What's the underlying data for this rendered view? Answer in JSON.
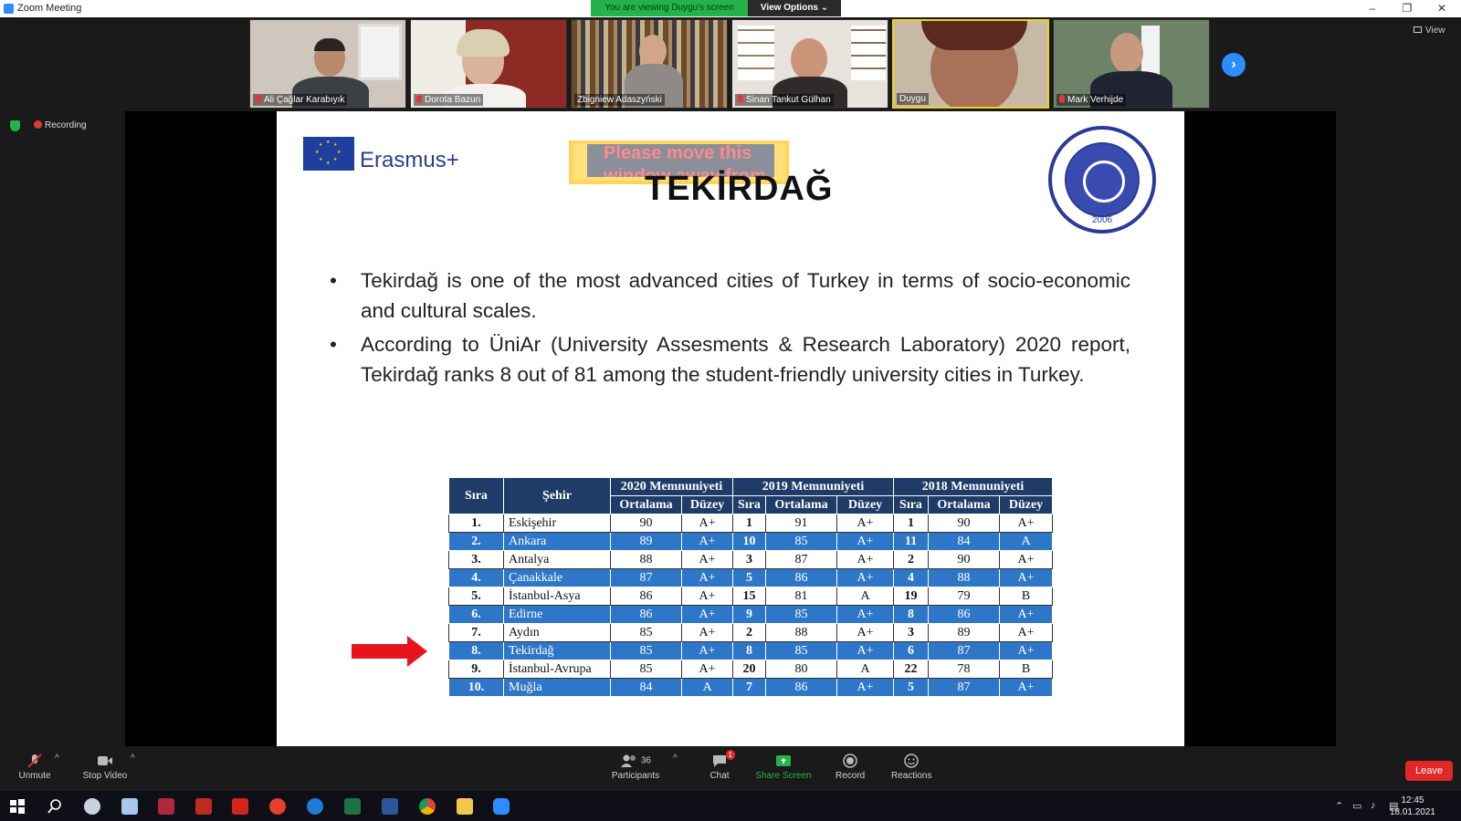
{
  "window": {
    "title": "Zoom Meeting",
    "min": "–",
    "max": "❐",
    "close": "✕"
  },
  "banner": {
    "viewing": "You are viewing Duygu's screen",
    "view_options": "View Options ⌄"
  },
  "gallery": {
    "participants": [
      {
        "name": "Ali Çağlar Karabıyık",
        "muted": true
      },
      {
        "name": "Dorota Bazun",
        "muted": true
      },
      {
        "name": "Zbigniew Adaszyński",
        "muted": false
      },
      {
        "name": "Sinan Tankut Gülhan",
        "muted": true
      },
      {
        "name": "Duygu",
        "muted": false
      },
      {
        "name": "Mark Verhijde",
        "muted": true
      }
    ],
    "next_icon": "›",
    "view_label": "View"
  },
  "status": {
    "recording": "Recording"
  },
  "slide": {
    "brand": "Erasmus+",
    "overlay_text": "Please move this window away from",
    "title": "TEKİRDAĞ",
    "seal_year": "2006",
    "bullet_symbol": "•",
    "bullets": [
      "Tekirdağ is one of the most advanced cities of Turkey in terms of socio-economic and cultural scales.",
      "According to ÜniAr (University Assesments & Research Laboratory) 2020 report, Tekirdağ ranks 8 out of 81 among the student-friendly university cities in Turkey."
    ],
    "table": {
      "h_rank": "Sıra",
      "h_city": "Şehir",
      "h_2020": "2020 Memnuniyeti",
      "h_2019": "2019 Memnuniyeti",
      "h_2018": "2018 Memnuniyeti",
      "h_avg": "Ortalama",
      "h_level": "Düzey",
      "h_sira": "Sıra",
      "rows": [
        {
          "rank": "1.",
          "city": "Eskişehir",
          "avg20": "90",
          "lvl20": "A+",
          "r19": "1",
          "avg19": "91",
          "lvl19": "A+",
          "r18": "1",
          "avg18": "90",
          "lvl18": "A+"
        },
        {
          "rank": "2.",
          "city": "Ankara",
          "avg20": "89",
          "lvl20": "A+",
          "r19": "10",
          "avg19": "85",
          "lvl19": "A+",
          "r18": "11",
          "avg18": "84",
          "lvl18": "A"
        },
        {
          "rank": "3.",
          "city": "Antalya",
          "avg20": "88",
          "lvl20": "A+",
          "r19": "3",
          "avg19": "87",
          "lvl19": "A+",
          "r18": "2",
          "avg18": "90",
          "lvl18": "A+"
        },
        {
          "rank": "4.",
          "city": "Çanakkale",
          "avg20": "87",
          "lvl20": "A+",
          "r19": "5",
          "avg19": "86",
          "lvl19": "A+",
          "r18": "4",
          "avg18": "88",
          "lvl18": "A+"
        },
        {
          "rank": "5.",
          "city": "İstanbul-Asya",
          "avg20": "86",
          "lvl20": "A+",
          "r19": "15",
          "avg19": "81",
          "lvl19": "A",
          "r18": "19",
          "avg18": "79",
          "lvl18": "B"
        },
        {
          "rank": "6.",
          "city": "Edirne",
          "avg20": "86",
          "lvl20": "A+",
          "r19": "9",
          "avg19": "85",
          "lvl19": "A+",
          "r18": "8",
          "avg18": "86",
          "lvl18": "A+"
        },
        {
          "rank": "7.",
          "city": "Aydın",
          "avg20": "85",
          "lvl20": "A+",
          "r19": "2",
          "avg19": "88",
          "lvl19": "A+",
          "r18": "3",
          "avg18": "89",
          "lvl18": "A+"
        },
        {
          "rank": "8.",
          "city": "Tekirdağ",
          "avg20": "85",
          "lvl20": "A+",
          "r19": "8",
          "avg19": "85",
          "lvl19": "A+",
          "r18": "6",
          "avg18": "87",
          "lvl18": "A+"
        },
        {
          "rank": "9.",
          "city": "İstanbul-Avrupa",
          "avg20": "85",
          "lvl20": "A+",
          "r19": "20",
          "avg19": "80",
          "lvl19": "A",
          "r18": "22",
          "avg18": "78",
          "lvl18": "B"
        },
        {
          "rank": "10.",
          "city": "Muğla",
          "avg20": "84",
          "lvl20": "A",
          "r19": "7",
          "avg19": "86",
          "lvl19": "A+",
          "r18": "5",
          "avg18": "87",
          "lvl18": "A+"
        }
      ]
    }
  },
  "toolbar": {
    "unmute": "Unmute",
    "stop_video": "Stop Video",
    "participants": "Participants",
    "participant_count": "36",
    "chat": "Chat",
    "chat_badge": "1",
    "share_screen": "Share Screen",
    "record": "Record",
    "reactions": "Reactions",
    "leave": "Leave",
    "caret": "^"
  },
  "taskbar": {
    "time": "12:45",
    "date": "18.01.2021"
  },
  "colors": {
    "accent": "#2d8cff",
    "share_green": "#23b34a",
    "leave_red": "#e02828",
    "table_blue": "#2e76c8",
    "table_header": "#1f3b68"
  }
}
